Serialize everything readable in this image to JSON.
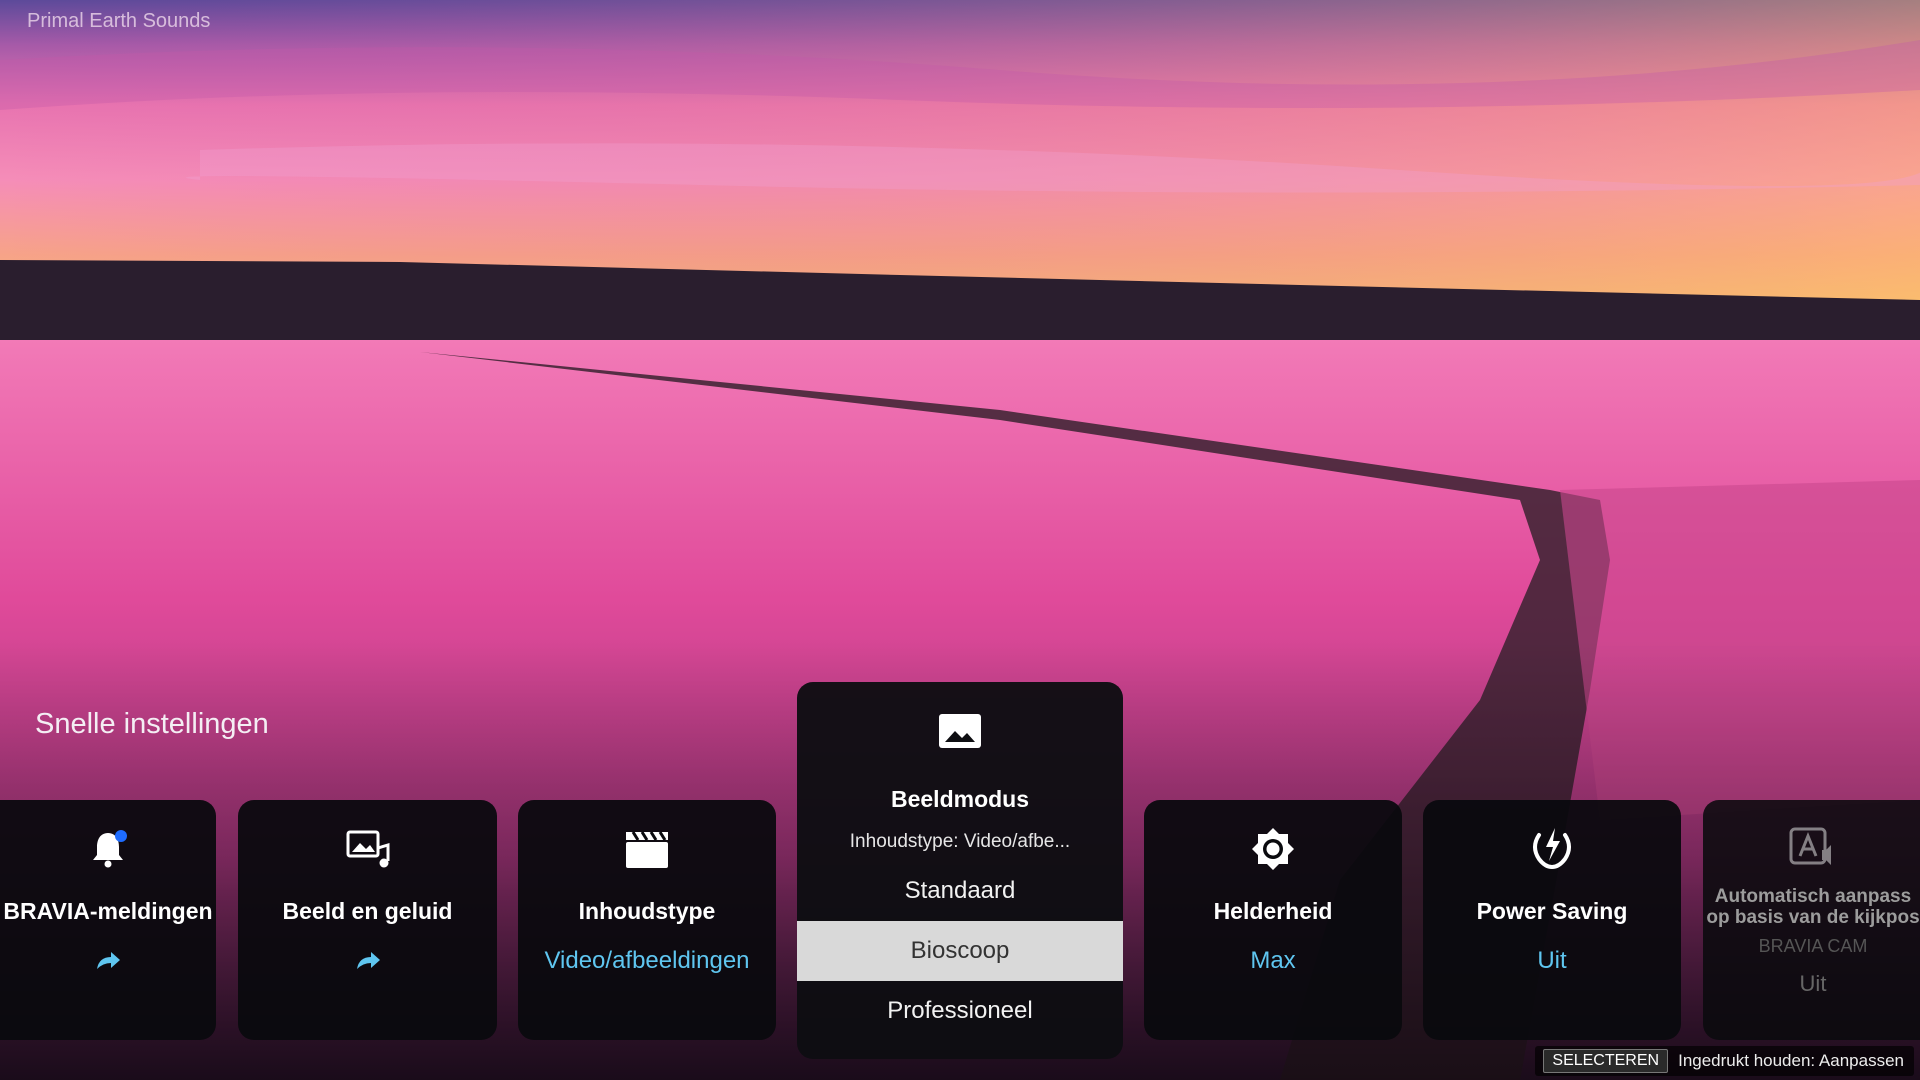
{
  "channel": {
    "title": "Primal Earth Sounds"
  },
  "quick_settings": {
    "title": "Snelle instellingen",
    "cards": [
      {
        "label": "BRAVIA-meldingen",
        "icon": "bell-notification-icon"
      },
      {
        "label": "Beeld en geluid",
        "icon": "picture-sound-icon"
      },
      {
        "label": "Inhoudstype",
        "value": "Video/afbeeldingen",
        "icon": "clapperboard-icon"
      },
      {
        "label": "Beeldmodus",
        "subtitle": "Inhoudstype: Video/afbe...",
        "icon": "picture-icon",
        "options": [
          "Standaard",
          "Bioscoop",
          "Professioneel"
        ],
        "selected": "Bioscoop"
      },
      {
        "label": "Helderheid",
        "value": "Max",
        "icon": "brightness-icon"
      },
      {
        "label": "Power Saving",
        "value": "Uit",
        "icon": "power-saving-icon"
      },
      {
        "label_line1": "Automatisch aanpass",
        "label_line2": "op basis van de kijkpos",
        "sublabel": "BRAVIA CAM",
        "value": "Uit",
        "icon": "auto-adjust-icon"
      }
    ]
  },
  "hint": {
    "key": "SELECTEREN",
    "text": "Ingedrukt houden: Aanpassen"
  },
  "colors": {
    "accent": "#5fc6f0",
    "notification_dot": "#1e6cff"
  }
}
